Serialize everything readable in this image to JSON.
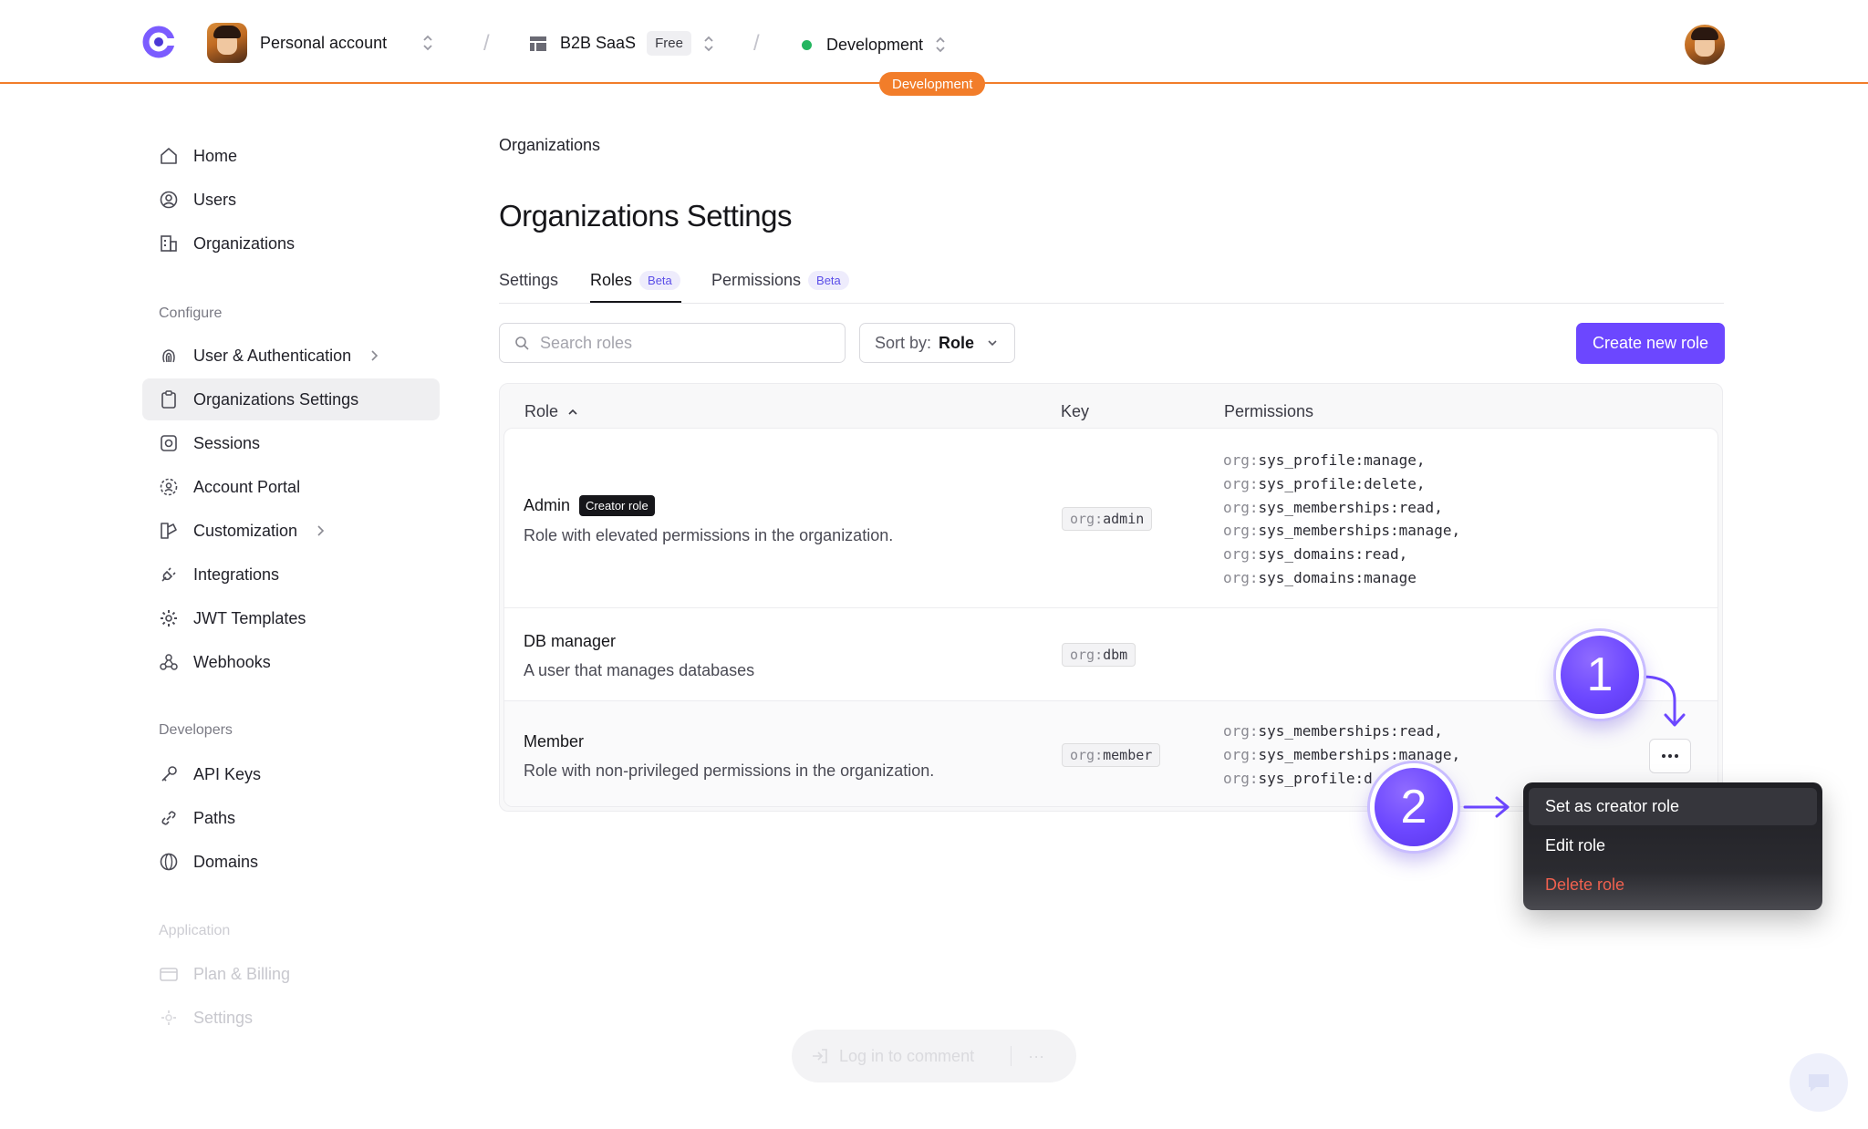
{
  "topbar": {
    "account_name": "Personal account",
    "app_name": "B2B SaaS",
    "plan_badge": "Free",
    "environment": "Development",
    "environment_tag": "Development",
    "env_dot_color": "#23b55f",
    "accent_color": "#f27d2a"
  },
  "sidebar": {
    "main": [
      {
        "label": "Home",
        "icon": "home-icon"
      },
      {
        "label": "Users",
        "icon": "user-circle-icon"
      },
      {
        "label": "Organizations",
        "icon": "building-icon"
      }
    ],
    "configure_heading": "Configure",
    "configure": [
      {
        "label": "User & Authentication",
        "icon": "fingerprint-icon"
      },
      {
        "label": "Organizations Settings",
        "icon": "clipboard-icon"
      },
      {
        "label": "Sessions",
        "icon": "session-icon"
      },
      {
        "label": "Account Portal",
        "icon": "portal-icon"
      },
      {
        "label": "Customization",
        "icon": "palette-icon"
      },
      {
        "label": "Integrations",
        "icon": "plug-icon"
      },
      {
        "label": "JWT Templates",
        "icon": "gear-icon"
      },
      {
        "label": "Webhooks",
        "icon": "webhook-icon"
      }
    ],
    "developers_heading": "Developers",
    "developers": [
      {
        "label": "API Keys",
        "icon": "key-icon"
      },
      {
        "label": "Paths",
        "icon": "link-icon"
      },
      {
        "label": "Domains",
        "icon": "globe-icon"
      }
    ],
    "application_heading": "Application",
    "application": [
      {
        "label": "Plan & Billing",
        "icon": "credit-card-icon"
      },
      {
        "label": "Settings",
        "icon": "settings-icon"
      }
    ]
  },
  "main": {
    "breadcrumb": "Organizations",
    "title": "Organizations Settings",
    "tabs": [
      {
        "label": "Settings"
      },
      {
        "label": "Roles",
        "badge": "Beta"
      },
      {
        "label": "Permissions",
        "badge": "Beta"
      }
    ],
    "search_placeholder": "Search roles",
    "sort_label": "Sort by:",
    "sort_value": "Role",
    "create_button": "Create new role",
    "primary_color": "#6c47ff"
  },
  "table": {
    "columns": [
      "Role",
      "Key",
      "Permissions"
    ],
    "rows": [
      {
        "name": "Admin",
        "badge": "Creator role",
        "description": "Role with elevated permissions in the organization.",
        "key_prefix": "org:",
        "key_suffix": "admin",
        "permissions": [
          {
            "pre": "org:",
            "rest": "sys_profile:manage,"
          },
          {
            "pre": "org:",
            "rest": "sys_profile:delete,"
          },
          {
            "pre": "org:",
            "rest": "sys_memberships:read,"
          },
          {
            "pre": "org:",
            "rest": "sys_memberships:manage,"
          },
          {
            "pre": "org:",
            "rest": "sys_domains:read,"
          },
          {
            "pre": "org:",
            "rest": "sys_domains:manage"
          }
        ]
      },
      {
        "name": "DB manager",
        "description": "A user that manages databases",
        "key_prefix": "org:",
        "key_suffix": "dbm"
      },
      {
        "name": "Member",
        "description": "Role with non-privileged permissions in the organization.",
        "key_prefix": "org:",
        "key_suffix": "member",
        "permissions": [
          {
            "pre": "org:",
            "rest": "sys_memberships:read,"
          },
          {
            "pre": "org:",
            "rest": "sys_memberships:manage,"
          },
          {
            "pre": "org:",
            "rest": "sys_profile:d"
          }
        ]
      }
    ],
    "more_button": "···"
  },
  "menu": {
    "items": [
      "Set as creator role",
      "Edit role",
      "Delete role"
    ],
    "danger_color": "#f0614f"
  },
  "callouts": [
    "1",
    "2"
  ],
  "footer": {
    "comment_label": "Log in to comment",
    "comment_more": "···"
  }
}
